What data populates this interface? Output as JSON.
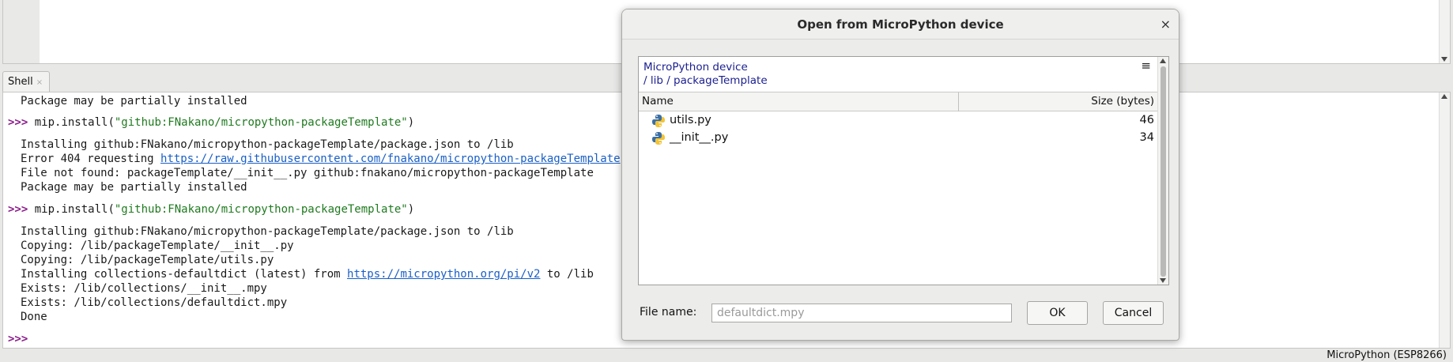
{
  "editor": {},
  "shell": {
    "tab_label": "Shell",
    "tab_close": "×",
    "lines": [
      {
        "kind": "out",
        "text": "Package may be partially installed"
      },
      {
        "kind": "cmd",
        "prompt": ">>>",
        "pre": " mip.install(",
        "str": "\"github:FNakano/micropython-packageTemplate\"",
        "post": ")"
      },
      {
        "kind": "out",
        "text": "Installing github:FNakano/micropython-packageTemplate/package.json to /lib"
      },
      {
        "kind": "out_link",
        "pre": "Error 404 requesting ",
        "link": "https://raw.githubusercontent.com/fnakano/micropython-packageTemplate",
        "post": ""
      },
      {
        "kind": "out",
        "text": "File not found: packageTemplate/__init__.py github:fnakano/micropython-packageTemplate"
      },
      {
        "kind": "out",
        "text": "Package may be partially installed"
      },
      {
        "kind": "cmd",
        "prompt": ">>>",
        "pre": " mip.install(",
        "str": "\"github:FNakano/micropython-packageTemplate\"",
        "post": ")"
      },
      {
        "kind": "out",
        "text": "Installing github:FNakano/micropython-packageTemplate/package.json to /lib"
      },
      {
        "kind": "out",
        "text": "Copying: /lib/packageTemplate/__init__.py"
      },
      {
        "kind": "out",
        "text": "Copying: /lib/packageTemplate/utils.py"
      },
      {
        "kind": "out_link",
        "pre": "Installing collections-defaultdict (latest) from ",
        "link": "https://micropython.org/pi/v2",
        "post": " to /lib"
      },
      {
        "kind": "out",
        "text": "Exists: /lib/collections/__init__.mpy"
      },
      {
        "kind": "out",
        "text": "Exists: /lib/collections/defaultdict.mpy"
      },
      {
        "kind": "out",
        "text": "Done"
      },
      {
        "kind": "prompt_only",
        "prompt": ">>>"
      }
    ]
  },
  "status": {
    "interpreter": "MicroPython (ESP8266)"
  },
  "dialog": {
    "title": "Open from MicroPython device",
    "close_glyph": "×",
    "location": {
      "device": "MicroPython device",
      "crumbs": "/ lib / packageTemplate",
      "menu_glyph": "≡"
    },
    "columns": {
      "name": "Name",
      "size": "Size (bytes)"
    },
    "files": [
      {
        "name": "utils.py",
        "size": "46",
        "icon": "python-file-icon"
      },
      {
        "name": "__init__.py",
        "size": "34",
        "icon": "python-file-icon"
      }
    ],
    "file_name_label": "File name:",
    "file_name_placeholder": "defaultdict.mpy",
    "ok_label": "OK",
    "cancel_label": "Cancel"
  },
  "colors": {
    "prompt": "#8b1e8b",
    "string": "#1f7a1f",
    "link": "#1a5fc7",
    "crumb": "#1b1f8f"
  }
}
